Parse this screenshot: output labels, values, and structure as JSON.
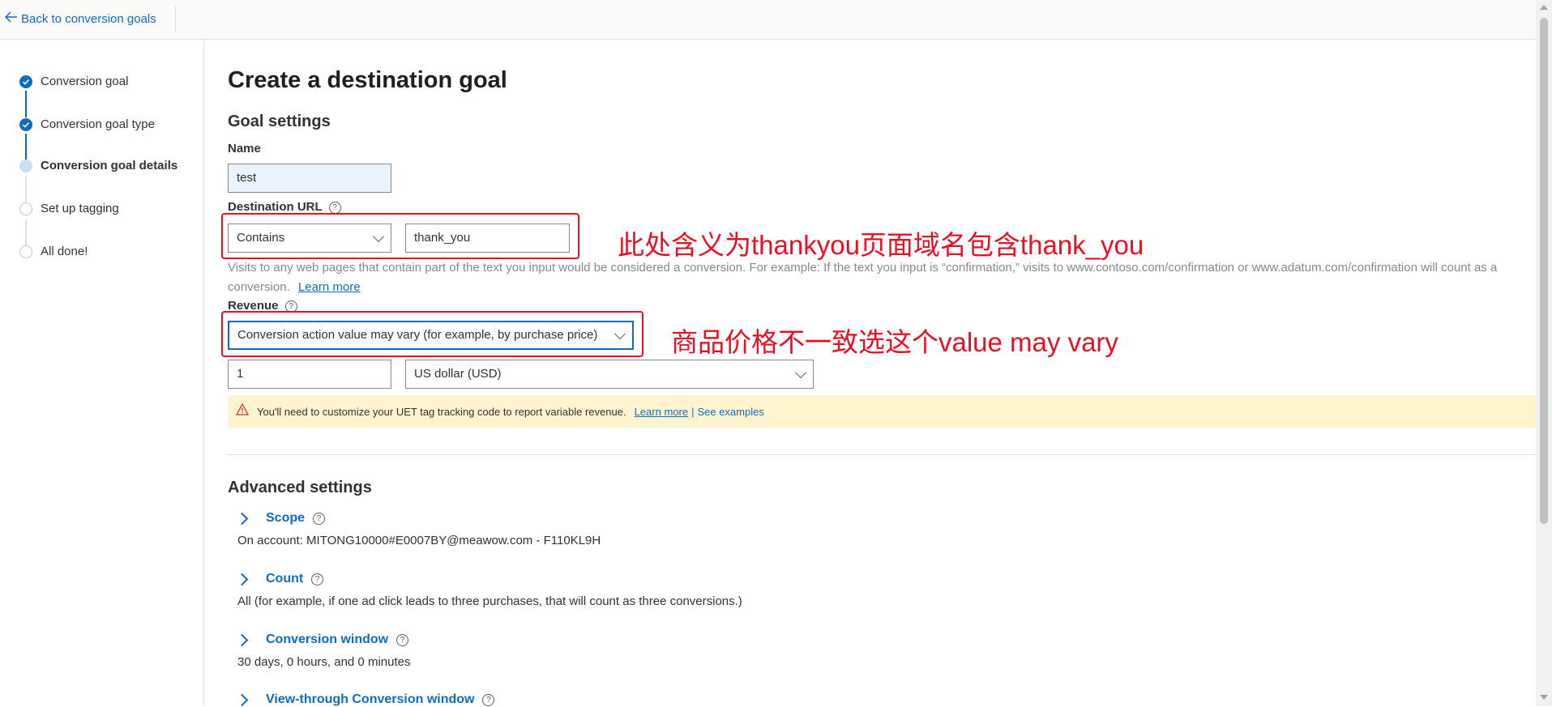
{
  "topbar": {
    "back_label": "Back to conversion goals"
  },
  "steps": [
    {
      "label": "Conversion goal",
      "state": "done"
    },
    {
      "label": "Conversion goal type",
      "state": "done"
    },
    {
      "label": "Conversion goal details",
      "state": "current"
    },
    {
      "label": "Set up tagging",
      "state": "todo"
    },
    {
      "label": "All done!",
      "state": "todo"
    }
  ],
  "page": {
    "title": "Create a destination goal",
    "goal_settings_heading": "Goal settings",
    "name_label": "Name",
    "name_value": "test",
    "dest_url_label": "Destination URL",
    "dest_operator": "Contains",
    "dest_value": "thank_you",
    "dest_hint": "Visits to any web pages that contain part of the text you input would be considered a conversion. For example: If the text you input is “confirmation,” visits to www.contoso.com/confirmation or www.adatum.com/confirmation will count as a conversion.",
    "dest_hint_link": "Learn more",
    "revenue_label": "Revenue",
    "revenue_option": "Conversion action value may vary (for example, by purchase price)",
    "revenue_amount": "1",
    "currency": "US dollar (USD)",
    "warning_text": "You'll need to customize your UET tag tracking code to report variable revenue.",
    "warning_link1": "Learn more",
    "warning_sep": "|",
    "warning_link2": "See examples",
    "advanced_heading": "Advanced settings",
    "advanced": [
      {
        "title": "Scope",
        "value": "On account: MITONG10000#E0007BY@meawow.com - F110KL9H"
      },
      {
        "title": "Count",
        "value": "All (for example, if one ad click leads to three purchases, that will count as three conversions.)"
      },
      {
        "title": "Conversion window",
        "value": "30 days, 0 hours, and 0 minutes"
      },
      {
        "title": "View-through Conversion window",
        "value": ""
      }
    ]
  },
  "annotations": {
    "note1": "此处含义为thankyou页面域名包含thank_you",
    "note2": "商品价格不一致选这个value may vary"
  },
  "colors": {
    "accent": "#0f6cbd",
    "annotation": "#e81123",
    "warning_bg": "#fff4ce"
  }
}
